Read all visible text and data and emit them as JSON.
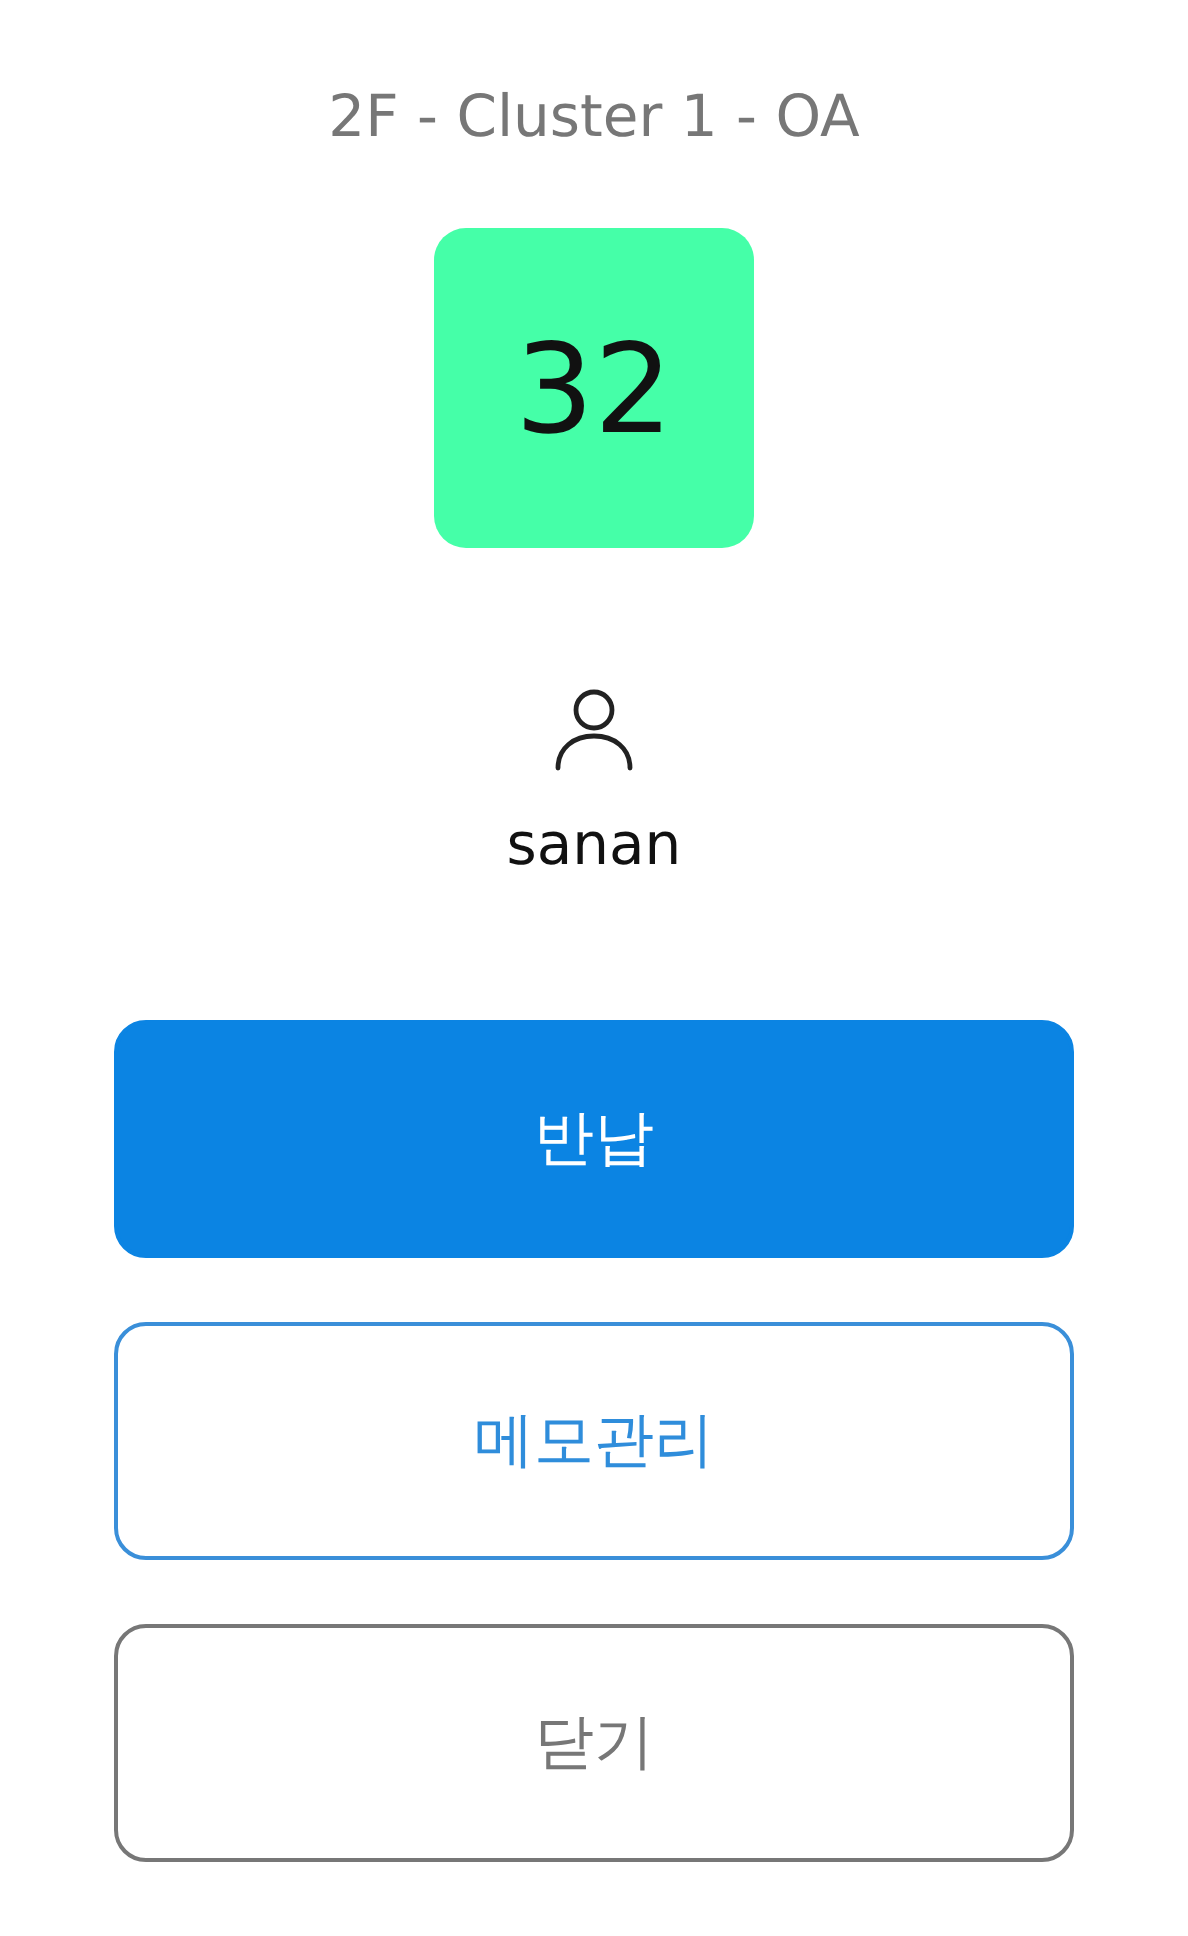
{
  "title": "2F - Cluster 1 - OA",
  "seat": {
    "number": "32"
  },
  "user": {
    "name": "sanan"
  },
  "buttons": [
    {
      "label": "반납",
      "kind": "primary"
    },
    {
      "label": "메모관리",
      "kind": "outline"
    },
    {
      "label": "닫기",
      "kind": "neutral"
    }
  ]
}
